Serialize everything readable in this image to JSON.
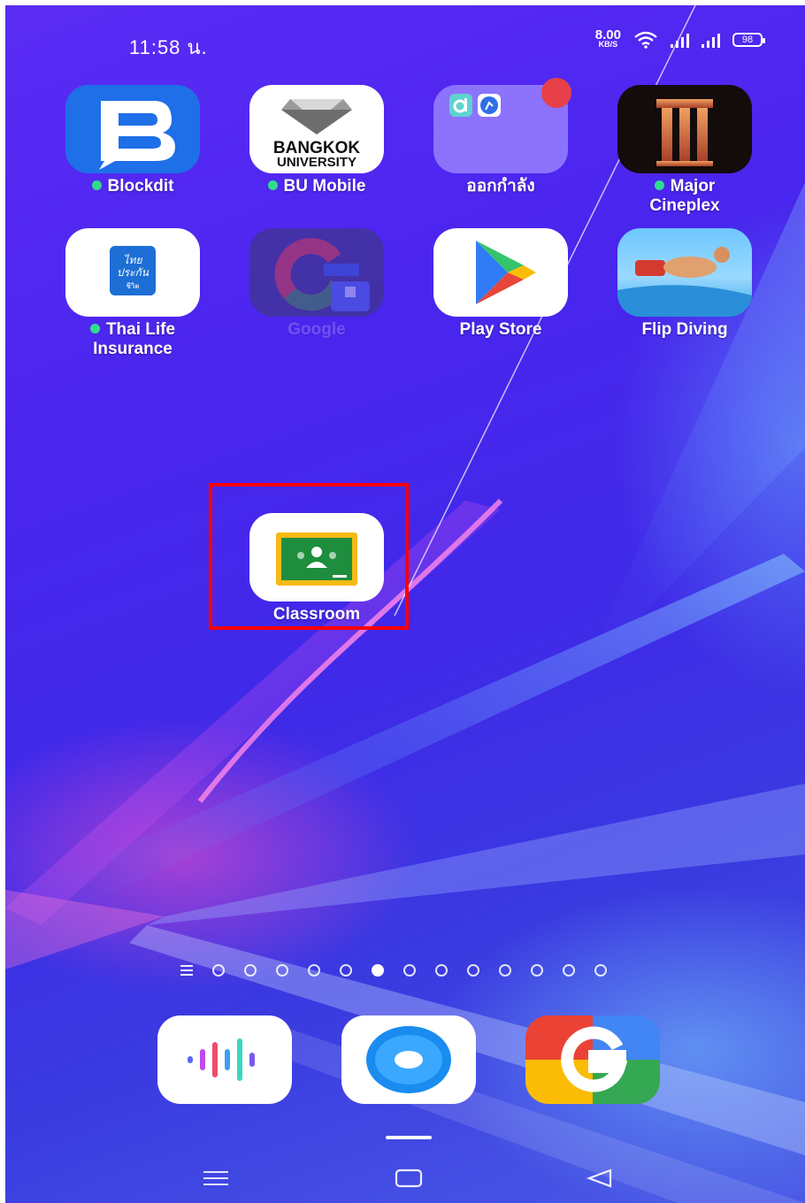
{
  "status_bar": {
    "time": "11:58 น.",
    "net_speed_value": "8.00",
    "net_speed_unit": "KB/S",
    "battery": "98"
  },
  "apps": [
    {
      "label": "Blockdit",
      "notification_dot": true,
      "icon": "blockdit-icon"
    },
    {
      "label": "BU Mobile",
      "notification_dot": true,
      "icon": "bangkok-university-icon",
      "icon_text_1": "BANGKOK",
      "icon_text_2": "UNIVERSITY"
    },
    {
      "label": "ออกกำลัง",
      "notification_dot": false,
      "icon": "folder-icon"
    },
    {
      "label_line1": "Major",
      "label_line2": "Cineplex",
      "notification_dot": true,
      "icon": "major-cineplex-icon"
    },
    {
      "label_line1": "Thai Life",
      "label_line2": "Insurance",
      "notification_dot": true,
      "icon": "thai-life-insurance-icon",
      "icon_text_1": "ไทย",
      "icon_text_2": "ประกัน",
      "icon_text_3": "ชีวิต"
    },
    {
      "label": "Google",
      "notification_dot": false,
      "icon": "google-work-icon"
    },
    {
      "label": "Play Store",
      "notification_dot": false,
      "icon": "play-store-icon"
    },
    {
      "label": "Flip Diving",
      "notification_dot": false,
      "icon": "flip-diving-icon"
    },
    {
      "label": "Classroom",
      "notification_dot": false,
      "icon": "google-classroom-icon"
    }
  ],
  "pager": {
    "page_count": 13,
    "active_index": 5
  },
  "dock": [
    {
      "icon": "sound-recorder-icon"
    },
    {
      "icon": "browser-icon"
    },
    {
      "icon": "google-go-icon"
    }
  ],
  "colors": {
    "highlight": "#ff0000",
    "notification_dot": "#2fdc8c",
    "badge": "#e84048",
    "wallpaper": "#4a25ee"
  }
}
